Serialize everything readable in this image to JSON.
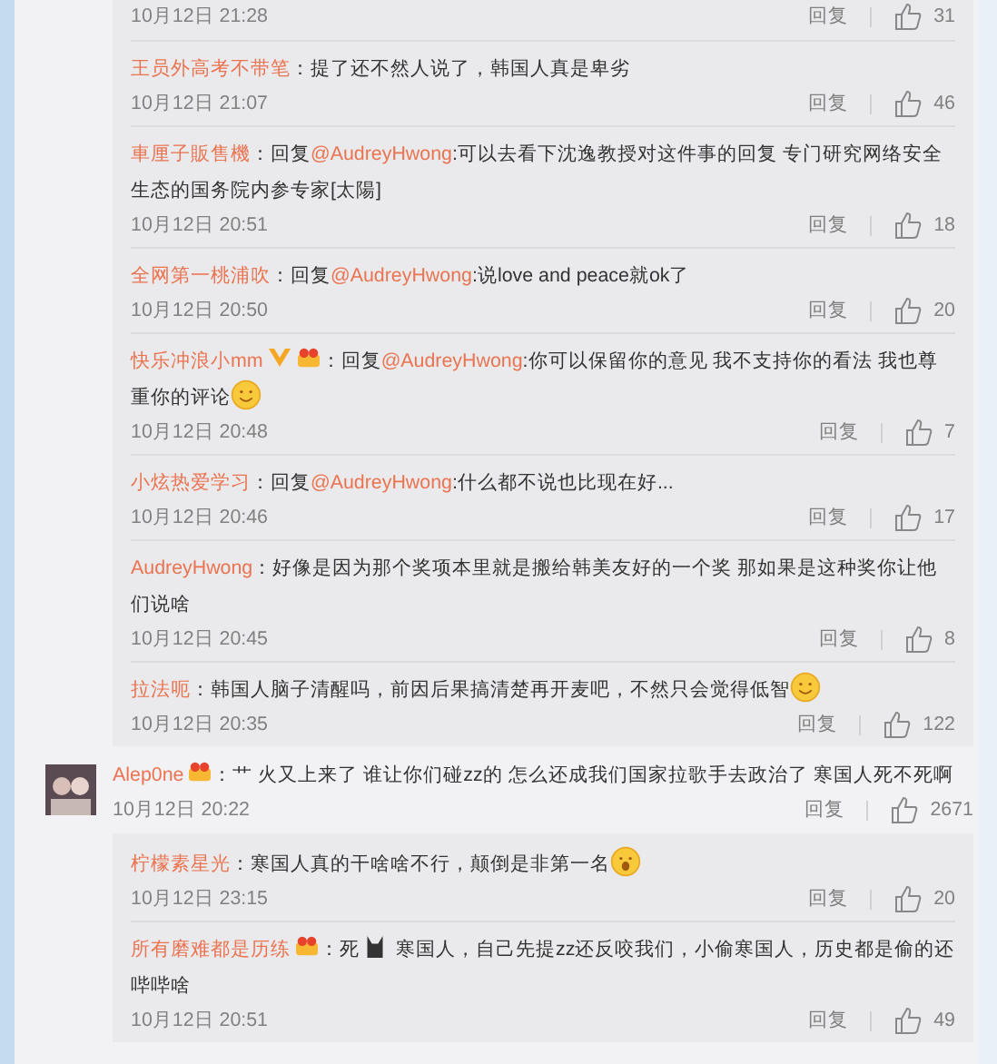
{
  "upper_replies": [
    {
      "time": "10月12日 21:28",
      "reply_label": "回复",
      "likes": "31"
    },
    {
      "user": "王员外高考不带笔",
      "segments": [
        {
          "kind": "text",
          "text": "：提了还不然人说了，韩国人真是卑劣"
        }
      ],
      "time": "10月12日 21:07",
      "reply_label": "回复",
      "likes": "46"
    },
    {
      "user": "車厘子販售機",
      "segments": [
        {
          "kind": "text",
          "text": "：回复"
        },
        {
          "kind": "mention",
          "text": "@AudreyHwong"
        },
        {
          "kind": "text",
          "text": ":可以去看下沈逸教授对这件事的回复 专门研究网络安全生态的国务院内参专家[太陽]"
        }
      ],
      "time": "10月12日 20:51",
      "reply_label": "回复",
      "likes": "18"
    },
    {
      "user": "全网第一桃浦吹",
      "segments": [
        {
          "kind": "text",
          "text": "：回复"
        },
        {
          "kind": "mention",
          "text": "@AudreyHwong"
        },
        {
          "kind": "text",
          "text": ":说love and peace就ok了"
        }
      ],
      "time": "10月12日 20:50",
      "reply_label": "回复",
      "likes": "20"
    },
    {
      "user": "快乐冲浪小mm",
      "verified": true,
      "vip": true,
      "segments": [
        {
          "kind": "text",
          "text": "：回复"
        },
        {
          "kind": "mention",
          "text": "@AudreyHwong"
        },
        {
          "kind": "text",
          "text": ":你可以保留你的意见 我不支持你的看法 我也尊重你的评论"
        },
        {
          "kind": "emoji"
        }
      ],
      "time": "10月12日 20:48",
      "reply_label": "回复",
      "likes": "7"
    },
    {
      "user": "小炫热爱学习",
      "segments": [
        {
          "kind": "text",
          "text": "：回复"
        },
        {
          "kind": "mention",
          "text": "@AudreyHwong"
        },
        {
          "kind": "text",
          "text": ":什么都不说也比现在好..."
        }
      ],
      "time": "10月12日 20:46",
      "reply_label": "回复",
      "likes": "17"
    },
    {
      "user": "AudreyHwong",
      "segments": [
        {
          "kind": "text",
          "text": "：好像是因为那个奖项本里就是搬给韩美友好的一个奖 那如果是这种奖你让他们说啥"
        }
      ],
      "time": "10月12日 20:45",
      "reply_label": "回复",
      "likes": "8"
    },
    {
      "user": "拉法呃",
      "segments": [
        {
          "kind": "text",
          "text": "：韩国人脑子清醒吗，前因后果搞清楚再开麦吧，不然只会觉得低智"
        },
        {
          "kind": "emoji"
        }
      ],
      "time": "10月12日 20:35",
      "reply_label": "回复",
      "likes": "122"
    }
  ],
  "comment": {
    "user": "Alep0ne",
    "vip": true,
    "segments": [
      {
        "kind": "text",
        "text": "：艹 火又上来了 谁让你们碰zz的 怎么还成我们国家拉歌手去政治了 寒国人死不死啊"
      }
    ],
    "time": "10月12日 20:22",
    "reply_label": "回复",
    "likes": "2671"
  },
  "lower_replies": [
    {
      "user": "柠檬素星光",
      "segments": [
        {
          "kind": "text",
          "text": "：寒国人真的干啥啥不行，颠倒是非第一名"
        },
        {
          "kind": "emoji"
        }
      ],
      "time": "10月12日 23:15",
      "reply_label": "回复",
      "likes": "20"
    },
    {
      "user": "所有磨难都是历练",
      "vip": true,
      "segments": [
        {
          "kind": "text",
          "text": "：死"
        },
        {
          "kind": "sticker"
        },
        {
          "kind": "text",
          "text": " 寒国人，自己先提zz还反咬我们，小偷寒国人，历史都是偷的还哔哔啥"
        }
      ],
      "time": "10月12日 20:51",
      "reply_label": "回复",
      "likes": "49"
    }
  ]
}
